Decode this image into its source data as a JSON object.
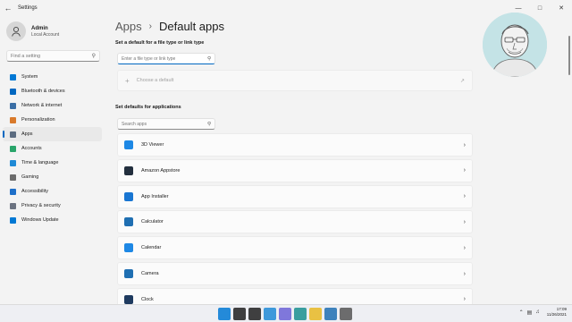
{
  "window": {
    "title": "Settings",
    "back_icon": "back-arrow-icon",
    "controls": [
      "minimize-icon",
      "maximize-icon",
      "close-icon"
    ]
  },
  "user": {
    "name": "Admin",
    "account_type": "Local Account"
  },
  "sidebar": {
    "search_placeholder": "Find a setting",
    "items": [
      {
        "label": "System",
        "icon": "monitor-icon",
        "color": "#0078d4",
        "active": false
      },
      {
        "label": "Bluetooth & devices",
        "icon": "bluetooth-icon",
        "color": "#0067c0",
        "active": false
      },
      {
        "label": "Network & internet",
        "icon": "wifi-icon",
        "color": "#3a6ea5",
        "active": false
      },
      {
        "label": "Personalization",
        "icon": "brush-icon",
        "color": "#d97a2b",
        "active": false
      },
      {
        "label": "Apps",
        "icon": "apps-icon",
        "color": "#5b6b80",
        "active": true
      },
      {
        "label": "Accounts",
        "icon": "person-icon",
        "color": "#2aa56b",
        "active": false
      },
      {
        "label": "Time & language",
        "icon": "globe-clock-icon",
        "color": "#1f8ad6",
        "active": false
      },
      {
        "label": "Gaming",
        "icon": "controller-icon",
        "color": "#6b6b6b",
        "active": false
      },
      {
        "label": "Accessibility",
        "icon": "accessibility-icon",
        "color": "#1e6fc9",
        "active": false
      },
      {
        "label": "Privacy & security",
        "icon": "shield-icon",
        "color": "#6b7280",
        "active": false
      },
      {
        "label": "Windows Update",
        "icon": "update-icon",
        "color": "#0078d4",
        "active": false
      }
    ]
  },
  "main": {
    "breadcrumb_parent": "Apps",
    "breadcrumb_sep": "›",
    "breadcrumb_current": "Default apps",
    "filetype_section_title": "Set a default for a file type or link type",
    "filetype_placeholder": "Enter a file type or link type",
    "choose_default_label": "Choose a default",
    "apps_section_title": "Set defaults for applications",
    "apps_search_placeholder": "Search apps",
    "apps": [
      {
        "name": "3D Viewer",
        "icon": "cube-icon",
        "color": "#1e88e5"
      },
      {
        "name": "Amazon Appstore",
        "icon": "amazon-icon",
        "color": "#232f3e"
      },
      {
        "name": "App Installer",
        "icon": "box-icon",
        "color": "#1976d2"
      },
      {
        "name": "Calculator",
        "icon": "calculator-icon",
        "color": "#1f6fb2"
      },
      {
        "name": "Calendar",
        "icon": "calendar-icon",
        "color": "#1e88e5"
      },
      {
        "name": "Camera",
        "icon": "camera-icon",
        "color": "#1f6fb2"
      },
      {
        "name": "Clock",
        "icon": "clock-icon",
        "color": "#1e3a5f"
      }
    ]
  },
  "taskbar": {
    "icons": [
      {
        "name": "start-icon",
        "color": "#0078d4"
      },
      {
        "name": "search-icon",
        "color": "#202020"
      },
      {
        "name": "task-view-icon",
        "color": "#202020"
      },
      {
        "name": "widgets-icon",
        "color": "#1f8ad6"
      },
      {
        "name": "chat-icon",
        "color": "#6b62d6"
      },
      {
        "name": "edge-icon",
        "color": "#1a8f8f"
      },
      {
        "name": "file-explorer-icon",
        "color": "#e8b923"
      },
      {
        "name": "store-icon",
        "color": "#1f6fb2"
      },
      {
        "name": "settings-icon",
        "color": "#555555"
      }
    ],
    "tray_icons": [
      "chevron-up-icon",
      "network-icon",
      "volume-icon"
    ],
    "time": "17:09",
    "date": "11/26/2021"
  }
}
